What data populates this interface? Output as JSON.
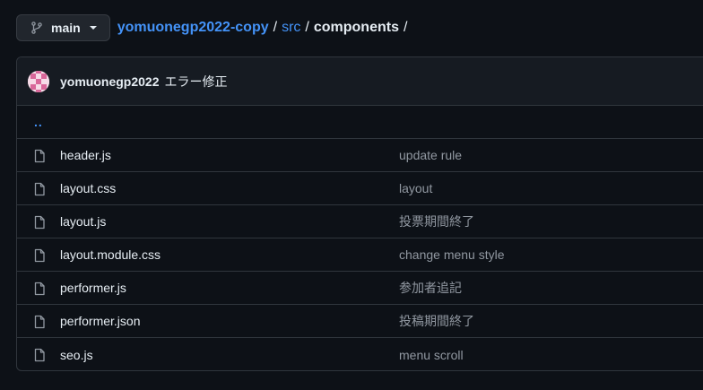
{
  "branch": {
    "label": "main",
    "icon": "git-branch-icon"
  },
  "breadcrumb": {
    "repo": "yomuonegp2022-copy",
    "sep1": "/",
    "dir": "src",
    "sep2": "/",
    "current": "components",
    "sep3": "/"
  },
  "commit": {
    "author": "yomuonegp2022",
    "message": "エラー修正"
  },
  "parent_dir": "..",
  "files": [
    {
      "name": "header.js",
      "commit": "update rule"
    },
    {
      "name": "layout.css",
      "commit": "layout"
    },
    {
      "name": "layout.js",
      "commit": "投票期間終了"
    },
    {
      "name": "layout.module.css",
      "commit": "change menu style"
    },
    {
      "name": "performer.js",
      "commit": "参加者追記"
    },
    {
      "name": "performer.json",
      "commit": "投稿期間終了"
    },
    {
      "name": "seo.js",
      "commit": "menu scroll"
    }
  ],
  "colors": {
    "background": "#0d1117",
    "link": "#4493f8",
    "border": "#30363d",
    "muted": "#9198a1"
  }
}
